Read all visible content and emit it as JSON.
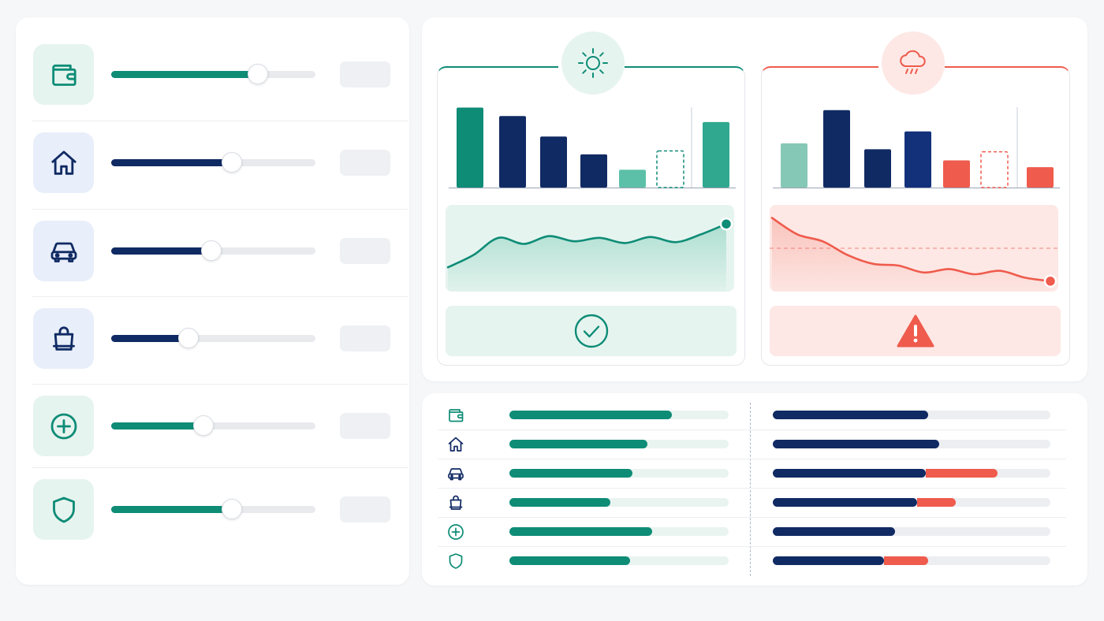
{
  "colors": {
    "green": "#0e8c76",
    "green_light": "#e6f4ef",
    "navy": "#102a63",
    "red": "#ef5b4c",
    "red_light": "#fde8e5",
    "track": "#e8eaee"
  },
  "allocations": [
    {
      "icon": "wallet-icon",
      "tone": "green",
      "level": 0.72
    },
    {
      "icon": "home-icon",
      "tone": "navy",
      "level": 0.59
    },
    {
      "icon": "car-icon",
      "tone": "navy",
      "level": 0.49
    },
    {
      "icon": "shopping-bag-icon",
      "tone": "navy",
      "level": 0.38
    },
    {
      "icon": "plus-circle-icon",
      "tone": "green",
      "level": 0.45
    },
    {
      "icon": "shield-icon",
      "tone": "green",
      "level": 0.59
    }
  ],
  "scenarios": {
    "good": {
      "icon": "sun-icon",
      "status_icon": "check-circle-icon",
      "bars": [
        0.94,
        0.84,
        0.6,
        0.39,
        0.21,
        0.43,
        0.77
      ],
      "bar_styles": [
        "green",
        "navy",
        "navy",
        "navy",
        "teal-light",
        "dashed",
        "teal"
      ],
      "trend": [
        0.28,
        0.42,
        0.62,
        0.55,
        0.64,
        0.58,
        0.62,
        0.56,
        0.63,
        0.57,
        0.66,
        0.78
      ]
    },
    "bad": {
      "icon": "cloud-rain-icon",
      "status_icon": "warning-icon",
      "bars": [
        0.52,
        0.91,
        0.45,
        0.66,
        0.32,
        0.42,
        0.24
      ],
      "bar_styles": [
        "green-light",
        "navy",
        "navy",
        "navy2",
        "red",
        "dashed-red",
        "red"
      ],
      "trend": [
        0.85,
        0.66,
        0.58,
        0.42,
        0.32,
        0.3,
        0.22,
        0.26,
        0.2,
        0.24,
        0.16,
        0.12
      ],
      "threshold": 0.5
    }
  },
  "comparison": [
    {
      "icon": "wallet-icon",
      "left": 0.74,
      "right": 0.56,
      "overrun": 0.0
    },
    {
      "icon": "home-icon",
      "left": 0.63,
      "right": 0.6,
      "overrun": 0.0
    },
    {
      "icon": "car-icon",
      "left": 0.56,
      "right": 0.55,
      "overrun": 0.26
    },
    {
      "icon": "shopping-bag-icon",
      "left": 0.46,
      "right": 0.52,
      "overrun": 0.14
    },
    {
      "icon": "plus-circle-icon",
      "left": 0.65,
      "right": 0.44,
      "overrun": 0.0
    },
    {
      "icon": "shield-icon",
      "left": 0.55,
      "right": 0.4,
      "overrun": 0.16
    }
  ]
}
